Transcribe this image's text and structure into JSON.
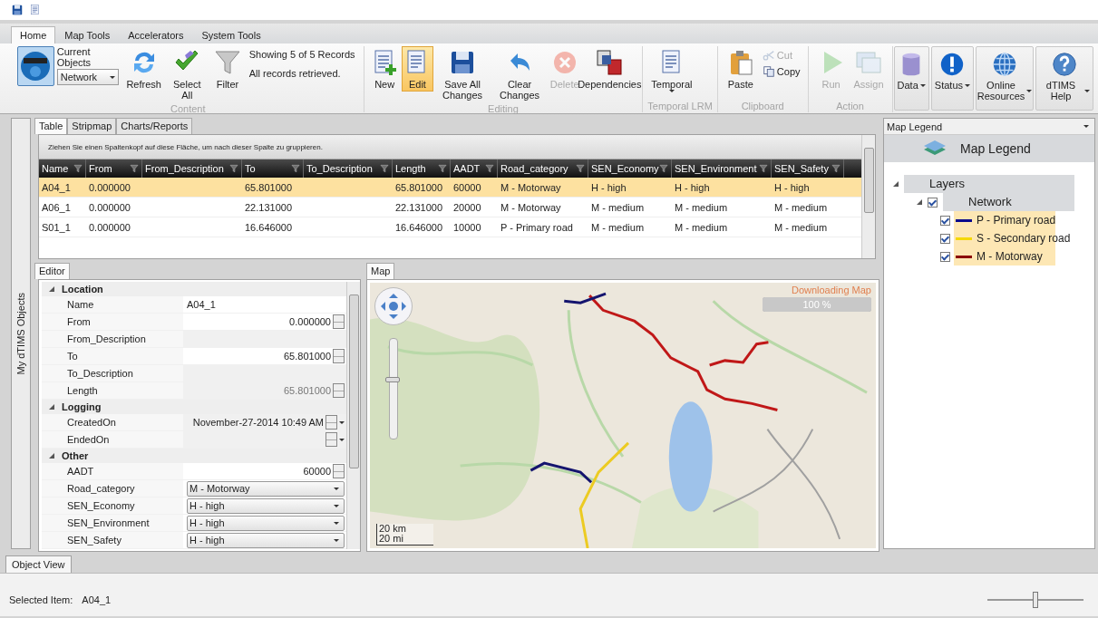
{
  "ribbon": {
    "tabs": [
      {
        "label": "Home",
        "selected": true
      },
      {
        "label": "Map Tools",
        "selected": false
      },
      {
        "label": "Accelerators",
        "selected": false
      },
      {
        "label": "System Tools",
        "selected": false
      }
    ],
    "groups": [
      {
        "label": "Content",
        "items": [
          {
            "kind": "logo",
            "selected": true
          },
          {
            "kind": "combo",
            "label": "Current Objects",
            "value": "Network"
          },
          {
            "kind": "large",
            "label": "Refresh",
            "disabled": false,
            "selected": false
          },
          {
            "kind": "large",
            "label": "Select All",
            "disabled": false,
            "selected": false
          },
          {
            "kind": "large",
            "label": "Filter",
            "disabled": false,
            "selected": false
          },
          {
            "kind": "info",
            "lines": [
              "Showing 5 of 5 Records",
              "All records retrieved."
            ]
          }
        ]
      },
      {
        "label": "Editing",
        "items": [
          {
            "kind": "large",
            "label": "New",
            "disabled": false,
            "selected": false
          },
          {
            "kind": "large",
            "label": "Edit",
            "disabled": false,
            "selected": true
          },
          {
            "kind": "large",
            "label": "Save All Changes",
            "disabled": false,
            "selected": false
          },
          {
            "kind": "large",
            "label": "Clear Changes",
            "disabled": false,
            "selected": false
          },
          {
            "kind": "large",
            "label": "Delete",
            "disabled": true,
            "selected": false
          },
          {
            "kind": "large",
            "label": "Dependencies",
            "disabled": false,
            "selected": false
          }
        ]
      },
      {
        "label": "Temporal LRM",
        "items": [
          {
            "kind": "dropdown",
            "label": "Temporal",
            "disabled": false,
            "selected": false
          }
        ]
      },
      {
        "label": "Clipboard",
        "items": [
          {
            "kind": "large",
            "label": "Paste",
            "disabled": false,
            "selected": false
          },
          {
            "kind": "small",
            "label": "Cut",
            "disabled": true,
            "selected": false
          },
          {
            "kind": "small",
            "label": "Copy",
            "disabled": false,
            "selected": false
          }
        ]
      },
      {
        "label": "Action",
        "items": [
          {
            "kind": "large",
            "label": "Run",
            "disabled": true,
            "selected": false
          },
          {
            "kind": "large",
            "label": "Assign",
            "disabled": true,
            "selected": false
          }
        ]
      }
    ],
    "menu_buttons": [
      {
        "label": "Data"
      },
      {
        "label": "Status"
      },
      {
        "label": "Online Resources"
      },
      {
        "label": "dTIMS Help"
      }
    ]
  },
  "side_strip": {
    "label": "My dTIMS Objects"
  },
  "table_panel": {
    "tabs": [
      {
        "label": "Table",
        "selected": true
      },
      {
        "label": "Stripmap",
        "selected": false
      },
      {
        "label": "Charts/Reports",
        "selected": false
      }
    ],
    "group_hint": "Ziehen Sie einen Spaltenkopf auf diese Fläche, um nach dieser Spalte zu gruppieren.",
    "columns": [
      "Name",
      "From",
      "From_Description",
      "To",
      "To_Description",
      "Length",
      "AADT",
      "Road_category",
      "SEN_Economy",
      "SEN_Environment",
      "SEN_Safety"
    ],
    "rows": [
      {
        "selected": true,
        "cells": [
          "A04_1",
          "0.000000",
          "",
          "65.801000",
          "",
          "65.801000",
          "60000",
          "M - Motorway",
          "H - high",
          "H - high",
          "H - high"
        ]
      },
      {
        "selected": false,
        "cells": [
          "A06_1",
          "0.000000",
          "",
          "22.131000",
          "",
          "22.131000",
          "20000",
          "M - Motorway",
          "M - medium",
          "M - medium",
          "M - medium"
        ]
      },
      {
        "selected": false,
        "cells": [
          "S01_1",
          "0.000000",
          "",
          "16.646000",
          "",
          "16.646000",
          "10000",
          "P - Primary road",
          "M - medium",
          "M - medium",
          "M - medium"
        ]
      }
    ]
  },
  "editor": {
    "tab": "Editor",
    "categories": [
      {
        "name": "Location",
        "expanded": true,
        "properties": [
          {
            "name": "Name",
            "kind": "text",
            "value": "A04_1",
            "disabled": false
          },
          {
            "name": "From",
            "kind": "spin",
            "value": "0.000000",
            "disabled": false
          },
          {
            "name": "From_Description",
            "kind": "text",
            "disabled": true
          },
          {
            "name": "To",
            "kind": "spin",
            "value": "65.801000",
            "disabled": false
          },
          {
            "name": "To_Description",
            "kind": "text",
            "disabled": true
          },
          {
            "name": "Length",
            "kind": "spin",
            "value": "65.801000",
            "disabled": true
          }
        ]
      },
      {
        "name": "Logging",
        "expanded": true,
        "properties": [
          {
            "name": "CreatedOn",
            "kind": "date",
            "value": "November-27-2014 10:49 AM",
            "disabled": true
          },
          {
            "name": "EndedOn",
            "kind": "date",
            "disabled": true
          }
        ]
      },
      {
        "name": "Other",
        "expanded": true,
        "properties": [
          {
            "name": "AADT",
            "kind": "spin",
            "value": "60000",
            "disabled": false
          },
          {
            "name": "Road_category",
            "kind": "combo",
            "value": "M - Motorway",
            "disabled": false
          },
          {
            "name": "SEN_Economy",
            "kind": "combo",
            "value": "H - high",
            "disabled": false
          },
          {
            "name": "SEN_Environment",
            "kind": "combo",
            "value": "H - high",
            "disabled": false
          },
          {
            "name": "SEN_Safety",
            "kind": "combo",
            "value": "H - high",
            "disabled": false
          }
        ]
      }
    ]
  },
  "map": {
    "tab": "Map",
    "download": {
      "text": "Downloading Map",
      "percent": "100 %",
      "level": 1
    },
    "zoom": {
      "level": 0.6
    },
    "scale": [
      "20 km",
      "20 mi"
    ]
  },
  "legend": {
    "header": "Map Legend",
    "title": "Map Legend",
    "tree": [
      {
        "label": "Layers",
        "expanded": true,
        "children": [
          {
            "label": "Network",
            "expanded": true,
            "checked": true,
            "children": [
              {
                "label": "P - Primary road",
                "checked": true,
                "color": "#0a0a8c"
              },
              {
                "label": "S - Secondary road",
                "checked": true,
                "color": "#f5d800"
              },
              {
                "label": "M - Motorway",
                "checked": true,
                "color": "#8b0000"
              }
            ]
          }
        ]
      }
    ]
  },
  "bottom_tabs": [
    {
      "label": "Object View",
      "selected": true
    }
  ],
  "status_bar": {
    "label": "Selected Item:",
    "value": "A04_1",
    "zoom": {
      "level": 0.5
    }
  }
}
